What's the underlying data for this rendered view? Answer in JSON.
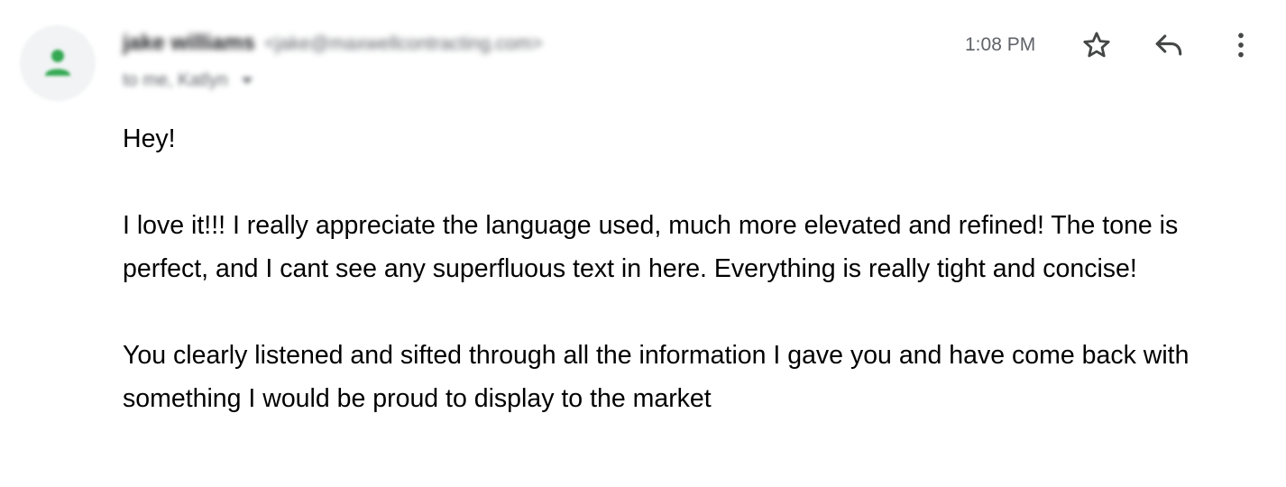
{
  "header": {
    "sender_name": "jake williams",
    "sender_email": "<jake@maxwellcontracting.com>",
    "recipients": "to me, Katlyn",
    "timestamp": "1:08 PM",
    "avatar_icon": "person-icon",
    "avatar_color": "#34a853"
  },
  "actions": {
    "star_icon": "star-icon",
    "reply_icon": "reply-icon",
    "more_icon": "more-vert-icon"
  },
  "body": {
    "greeting": "Hey!",
    "paragraph1": "I love it!!! I really appreciate the language used, much more elevated and refined! The tone is perfect, and I cant see any superfluous text in here. Everything is really tight and concise!",
    "paragraph2": "You clearly listened and sifted through all the information I gave you and have come back with something I would be proud to display to the market"
  }
}
